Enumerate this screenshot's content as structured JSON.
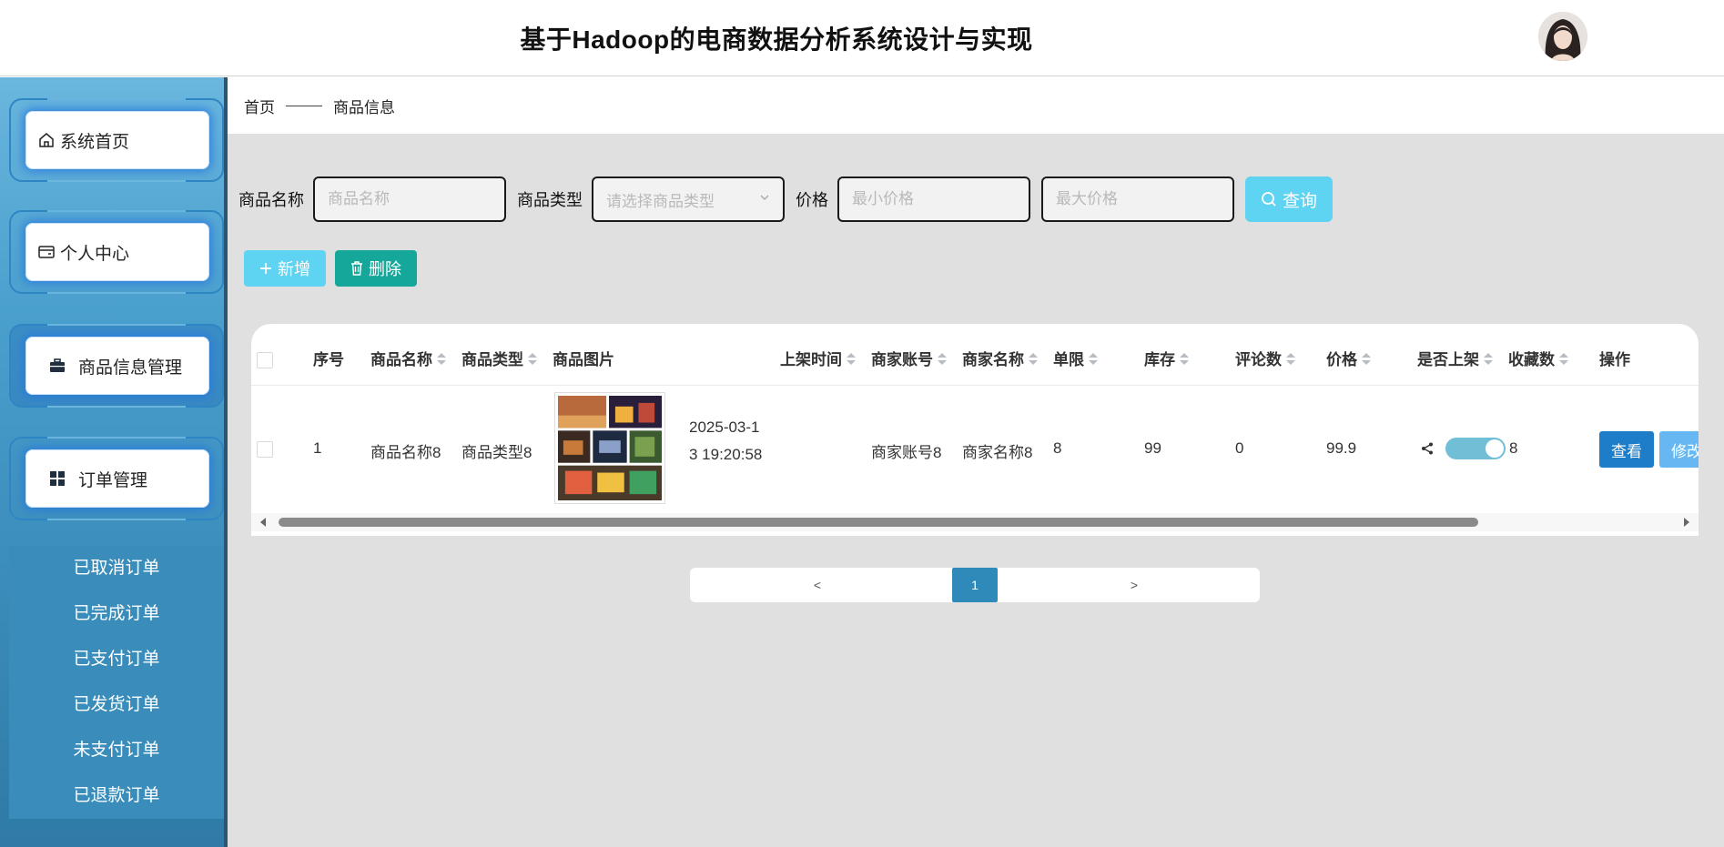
{
  "header": {
    "title": "基于Hadoop的电商数据分析系统设计与实现"
  },
  "sidebar": {
    "menu": [
      {
        "label": "系统首页",
        "icon": "home-icon"
      },
      {
        "label": "个人中心",
        "icon": "wallet-icon"
      },
      {
        "label": "商品信息管理",
        "icon": "briefcase-icon"
      },
      {
        "label": "订单管理",
        "icon": "grid-icon"
      }
    ],
    "submenu": [
      "已取消订单",
      "已完成订单",
      "已支付订单",
      "已发货订单",
      "未支付订单",
      "已退款订单"
    ]
  },
  "breadcrumb": {
    "home": "首页",
    "current": "商品信息"
  },
  "search": {
    "name_label": "商品名称",
    "name_placeholder": "商品名称",
    "type_label": "商品类型",
    "type_placeholder": "请选择商品类型",
    "price_label": "价格",
    "min_placeholder": "最小价格",
    "max_placeholder": "最大价格",
    "query_label": "查询"
  },
  "actions": {
    "add_label": "新增",
    "delete_label": "删除"
  },
  "table": {
    "columns": [
      "序号",
      "商品名称",
      "商品类型",
      "商品图片",
      "上架时间",
      "商家账号",
      "商家名称",
      "单限",
      "库存",
      "评论数",
      "价格",
      "是否上架",
      "收藏数",
      "操作"
    ],
    "rows": [
      {
        "index": "1",
        "name": "商品名称8",
        "type": "商品类型8",
        "time_line1": "2025-03-1",
        "time_line2": "3 19:20:58",
        "merchant_account": "商家账号8",
        "merchant_name": "商家名称8",
        "limit": "8",
        "stock": "99",
        "comments": "0",
        "price": "99.9",
        "favorites": "8",
        "view_label": "查看",
        "edit_label": "修改",
        "on_shelf": true
      }
    ]
  },
  "pagination": {
    "prev": "<",
    "page": "1",
    "next": ">"
  },
  "colors": {
    "accent": "#5fd3f2",
    "delete": "#15a89a",
    "view": "#1d7dc8",
    "page_active": "#2f89b9"
  }
}
